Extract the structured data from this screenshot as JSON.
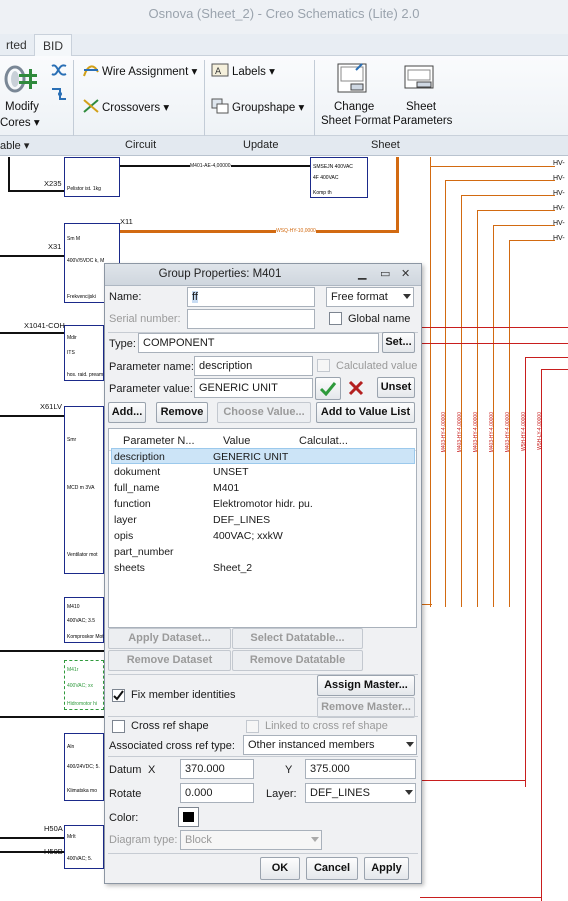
{
  "window": {
    "title": "Osnova (Sheet_2) - Creo Schematics (Lite) 2.0"
  },
  "tabs": [
    {
      "label": "rted"
    },
    {
      "label": "BID"
    }
  ],
  "ribbon": {
    "modify_cores": {
      "line1": "Modify",
      "line2": "Cores"
    },
    "wire_assignment": "Wire Assignment",
    "crossovers": "Crossovers",
    "labels": "Labels",
    "groupshape": "Groupshape",
    "change_sheet_format": {
      "line1": "Change",
      "line2": "Sheet Format"
    },
    "sheet_parameters": {
      "line1": "Sheet",
      "line2": "Parameters"
    }
  },
  "group_labels": {
    "table": "able",
    "circuit": "Circuit",
    "update": "Update",
    "sheet": "Sheet"
  },
  "canvas": {
    "labels": [
      "X235",
      "X11",
      "X31",
      "X1041-COH",
      "X61LV",
      "H50A",
      "H50B"
    ],
    "right_labels": [
      "HV-",
      "HV-",
      "HV-",
      "HV-",
      "HV-",
      "HV-"
    ],
    "wire_labels": [
      "M401-AE-4,00000",
      "WSQ-HY-10,0000"
    ],
    "vertical_labels": [
      "M403-HY-4,00000",
      "M403-HY-4,00000",
      "M403-HY-4,00000",
      "M403-HY-4,00000",
      "M403-HY-4,00000",
      "W5H-HY-4,00000",
      "W5H-HY-4,00000",
      "W5H-HY-4,00000",
      "W5H-LY-4,00000"
    ],
    "block_texts": [
      "Pelistor ist. 1kg",
      "Sm M",
      "400V/5VDC k, M",
      "Frekvencijski",
      "Mdir",
      "ITS",
      "hos. raid. pream",
      "Smr",
      "MCD m 3VA",
      "Ventilator mot",
      "M410",
      "400VAC; 3.5",
      "Komproskor Mot",
      "M41r",
      "400VAC; xx",
      "Hidromotor hi",
      "Aln",
      "400/24VDC; 5.",
      "Klimatska mo",
      "MrIt",
      "400VAC; 5.",
      "SMSEJN 400VAC",
      "4F 400VAC",
      "Komp th"
    ]
  },
  "dialog": {
    "title": "Group Properties: M401",
    "name_label": "Name:",
    "name_value": "ff",
    "format_value": "Free format",
    "serial_label": "Serial number:",
    "global_name_label": "Global name",
    "type_label": "Type:",
    "type_value": "COMPONENT",
    "set_button": "Set...",
    "param_name_label": "Parameter name:",
    "param_name_value": "description",
    "calculated_label": "Calculated value",
    "param_value_label": "Parameter value:",
    "param_value_value": "GENERIC UNIT",
    "unset_button": "Unset",
    "add_button": "Add...",
    "remove_button": "Remove",
    "choose_value_button": "Choose Value...",
    "add_to_value_list_button": "Add to Value List",
    "table": {
      "headers": [
        "Parameter N...",
        "Value",
        "Calculat..."
      ],
      "rows": [
        {
          "name": "description",
          "value": "GENERIC UNIT"
        },
        {
          "name": "dokument",
          "value": "UNSET"
        },
        {
          "name": "full_name",
          "value": "M401"
        },
        {
          "name": "function",
          "value": "Elektromotor hidr. pu."
        },
        {
          "name": "layer",
          "value": "DEF_LINES"
        },
        {
          "name": "opis",
          "value": "400VAC; xxkW"
        },
        {
          "name": "part_number",
          "value": ""
        },
        {
          "name": "sheets",
          "value": "Sheet_2"
        }
      ]
    },
    "apply_dataset_button": "Apply Dataset...",
    "select_datatable_button": "Select Datatable...",
    "remove_dataset_button": "Remove Dataset",
    "remove_datatable_button": "Remove Datatable",
    "fix_member_label": "Fix member identities",
    "assign_master_button": "Assign Master...",
    "remove_master_button": "Remove Master...",
    "cross_ref_shape_label": "Cross ref shape",
    "linked_cross_ref_label": "Linked to cross ref shape",
    "assoc_cross_ref_label": "Associated cross ref type:",
    "assoc_cross_ref_value": "Other instanced members",
    "datum_label": "Datum",
    "x_label": "X",
    "x_value": "370.000",
    "y_label": "Y",
    "y_value": "375.000",
    "rotate_label": "Rotate",
    "rotate_value": "0.000",
    "layer_label": "Layer:",
    "layer_value": "DEF_LINES",
    "color_label": "Color:",
    "color_value": "#000000",
    "diagram_type_label": "Diagram type:",
    "diagram_type_value": "Block",
    "ok_button": "OK",
    "cancel_button": "Cancel",
    "apply_button": "Apply"
  }
}
